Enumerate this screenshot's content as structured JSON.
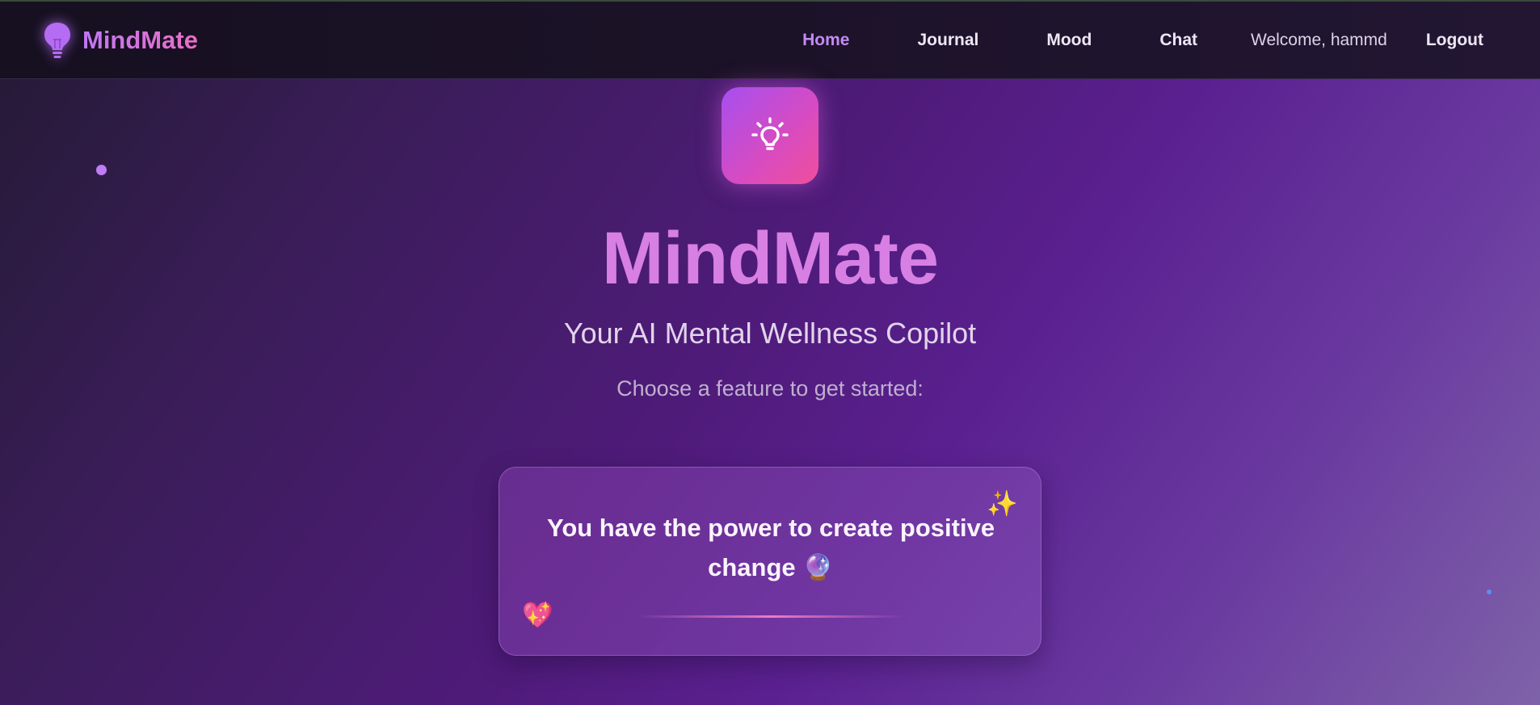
{
  "nav": {
    "brand": "MindMate",
    "links": [
      {
        "label": "Home",
        "active": true
      },
      {
        "label": "Journal"
      },
      {
        "label": "Mood"
      },
      {
        "label": "Chat"
      }
    ],
    "welcome": "Welcome, hammd",
    "logout": "Logout"
  },
  "hero": {
    "title": "MindMate",
    "subtitle": "Your AI Mental Wellness Copilot",
    "prompt": "Choose a feature to get started:"
  },
  "quote": {
    "text": "You have the power to create positive change 🔮",
    "sparkle": "✨",
    "heart": "💖"
  },
  "icons": {
    "brand": "lightbulb-icon",
    "hero": "lightbulb-icon"
  },
  "colors": {
    "accent": "#c48af6",
    "title": "#d77fe3",
    "hero_icon_gradient": [
      "#a64ff0",
      "#ef4f9c"
    ]
  }
}
